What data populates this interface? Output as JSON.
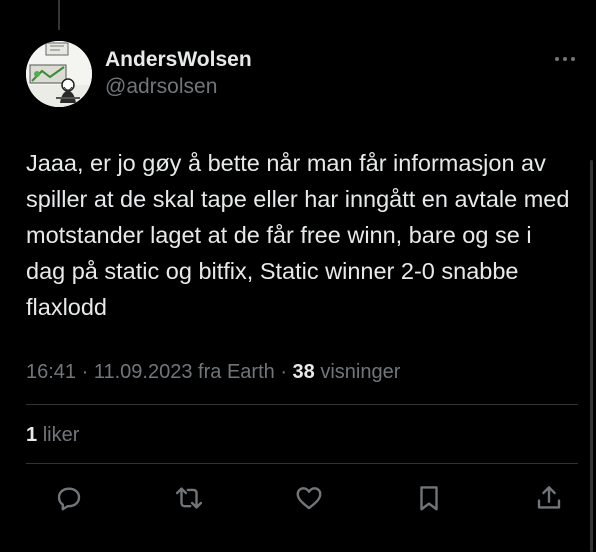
{
  "author": {
    "display_name": "AndersWolsen",
    "handle": "@adrsolsen",
    "avatar_icon": "cartoon-avatar"
  },
  "tweet": {
    "text": "Jaaa, er jo gøy å bette når man får informasjon av spiller at de skal tape eller har inngått en avtale med motstander laget at de får free winn, bare og se i dag på static og bitfix, Static winner 2-0 snabbe flaxlodd",
    "time": "16:41",
    "separator": "·",
    "date": "11.09.2023",
    "source": "fra Earth",
    "views_count": "38",
    "views_label": "visninger"
  },
  "stats": {
    "likes_count": "1",
    "likes_label": "liker"
  },
  "actions": [
    {
      "name": "reply",
      "icon": "reply-icon"
    },
    {
      "name": "retweet",
      "icon": "retweet-icon"
    },
    {
      "name": "like",
      "icon": "heart-icon"
    },
    {
      "name": "bookmark",
      "icon": "bookmark-icon"
    },
    {
      "name": "share",
      "icon": "share-icon"
    }
  ],
  "colors": {
    "background": "#000000",
    "primary_text": "#e7e9ea",
    "secondary_text": "#71767b",
    "divider": "#2f3336"
  }
}
